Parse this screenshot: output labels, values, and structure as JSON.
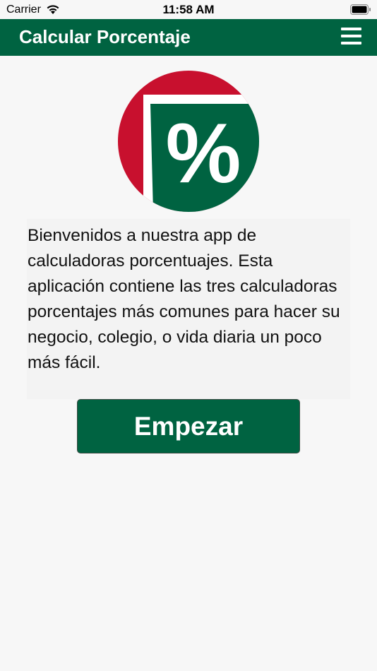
{
  "status_bar": {
    "carrier": "Carrier",
    "time": "11:58 AM",
    "icons": [
      "wifi-icon",
      "battery-icon"
    ]
  },
  "nav_bar": {
    "title": "Calcular Porcentaje",
    "menu_icon": "hamburger-menu-icon",
    "color": "#006341"
  },
  "logo": {
    "glyph": "%",
    "colors": {
      "red": "#c8102e",
      "green": "#006341",
      "white": "#ffffff"
    }
  },
  "main": {
    "intro_text": "Bienvenidos a nuestra app de calculadoras porcentuajes. Esta aplicación contiene las tres calculadoras porcentajes más comunes para hacer su negocio, colegio, o vida diaria un poco más fácil.",
    "start_button_label": "Empezar"
  }
}
